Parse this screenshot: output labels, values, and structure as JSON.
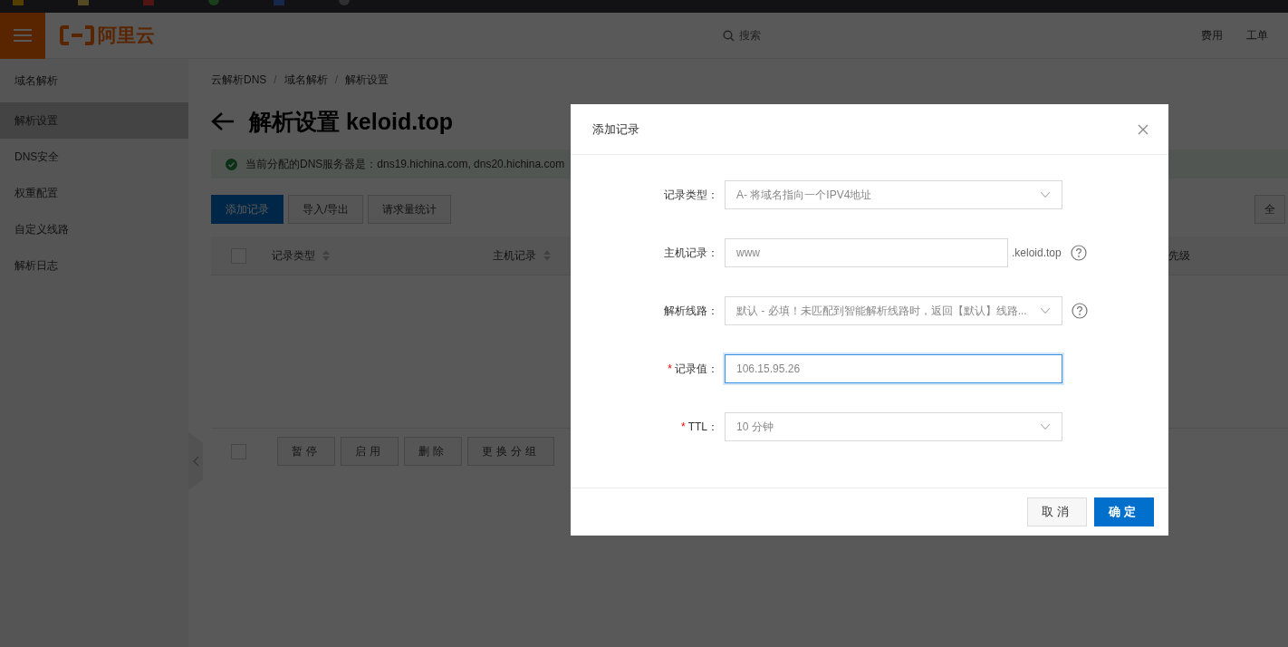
{
  "header": {
    "logo": "阿里云",
    "search_placeholder": "搜索",
    "links": [
      "费用",
      "工单"
    ]
  },
  "sidebar": {
    "items": [
      {
        "label": "域名解析",
        "selected": false
      },
      {
        "label": "解析设置",
        "selected": true
      },
      {
        "label": "DNS安全",
        "selected": false
      },
      {
        "label": "权重配置",
        "selected": false
      },
      {
        "label": "自定义线路",
        "selected": false
      },
      {
        "label": "解析日志",
        "selected": false
      }
    ]
  },
  "breadcrumb": [
    {
      "kind": "link",
      "text": "云解析DNS"
    },
    {
      "kind": "separator",
      "text": "/"
    },
    {
      "kind": "link",
      "text": "域名解析"
    },
    {
      "kind": "separator",
      "text": "/"
    },
    {
      "kind": "link",
      "text": "解析设置"
    }
  ],
  "page_title": "解析设置 keloid.top",
  "notice": "当前分配的DNS服务器是：dns19.hichina.com, dns20.hichina.com",
  "toolbar": {
    "buttons": [
      {
        "label": "添加记录",
        "primary": true
      },
      {
        "label": "导入/导出",
        "primary": false
      },
      {
        "label": "请求量统计",
        "primary": false
      }
    ],
    "right_button": "全"
  },
  "table": {
    "select_all_checked": false,
    "columns": [
      {
        "label": "记录类型",
        "sortable": true
      },
      {
        "label": "主机记录",
        "sortable": true
      },
      {
        "label": "先级",
        "sortable": false
      }
    ]
  },
  "bulk_checked": false,
  "bulk_actions": [
    {
      "label": "暂停",
      "disabled": true
    },
    {
      "label": "启用",
      "disabled": true
    },
    {
      "label": "删除",
      "disabled": true
    },
    {
      "label": "更换分组",
      "disabled": true
    }
  ],
  "dialog": {
    "title": "添加记录",
    "fields": [
      {
        "label": "记录类型：",
        "kind": "select",
        "value": "A- 将域名指向一个IPV4地址",
        "help": false,
        "focused": false
      },
      {
        "label": "主机记录：",
        "kind": "input",
        "placeholder": "www",
        "suffix": ".keloid.top",
        "help": true,
        "focused": false
      },
      {
        "label": "解析线路：",
        "kind": "select",
        "value": "默认 - 必填！未匹配到智能解析线路时，返回【默认】线路...",
        "help": true,
        "focused": false
      },
      {
        "label": "记录值：",
        "kind": "input",
        "placeholder": "106.15.95.26",
        "required_mark": "*",
        "help": false,
        "focused": true
      },
      {
        "label": "TTL：",
        "kind": "select",
        "value": "10 分钟",
        "required_mark": "*",
        "help": false,
        "focused": false
      }
    ],
    "buttons": [
      {
        "label": "取消",
        "primary": false
      },
      {
        "label": "确定",
        "primary": true
      }
    ]
  }
}
